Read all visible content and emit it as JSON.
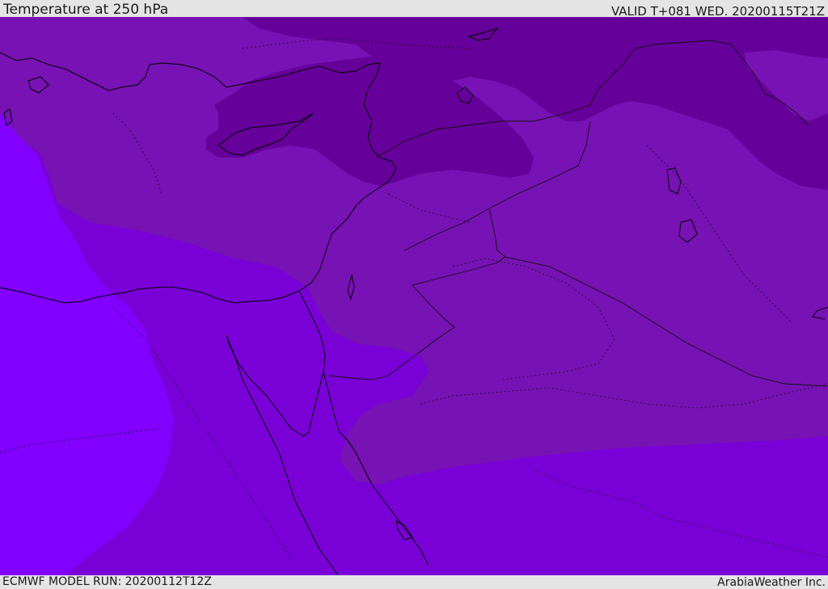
{
  "header": {
    "title": "Temperature at 250 hPa",
    "valid_time": "VALID T+081 WED. 20200115T21Z"
  },
  "footer": {
    "model_run": "ECMWF MODEL RUN: 20200112T12Z",
    "credit": "ArabiaWeather Inc."
  },
  "map": {
    "colors": {
      "coldest": "#66009a",
      "cold": "#7712b4",
      "mid": "#7a00d8",
      "warm": "#8100ff",
      "coastline": "#000000",
      "border": "#222222"
    }
  }
}
